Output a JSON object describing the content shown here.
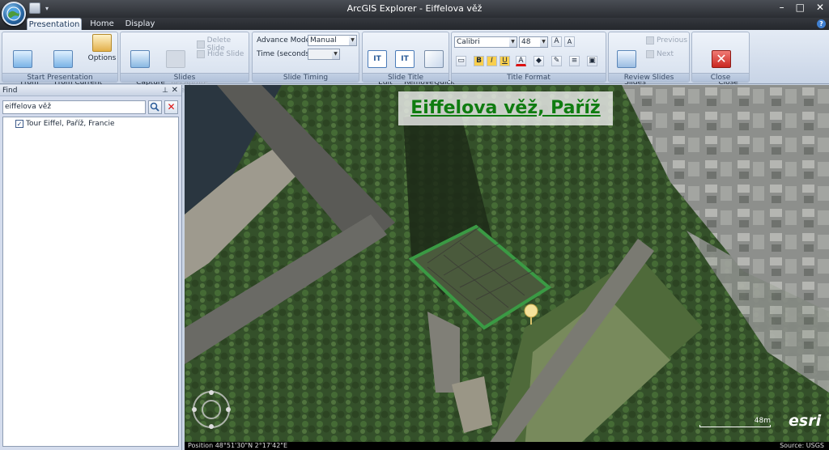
{
  "window": {
    "title": "ArcGIS Explorer - Eiffelova věž"
  },
  "tabs": [
    {
      "label": "Presentation"
    },
    {
      "label": "Home"
    },
    {
      "label": "Display"
    }
  ],
  "ribbon": {
    "start_presentation": {
      "caption": "Start Presentation",
      "from_beginning": "From\nBeginning",
      "from_current": "From Current\nSlide",
      "options": "Options"
    },
    "slides": {
      "caption": "Slides",
      "capture": "Capture\nNew Slide",
      "recapture": "Recapture\nSlide",
      "delete": "Delete Slide",
      "hide": "Hide Slide"
    },
    "slide_timing": {
      "caption": "Slide Timing",
      "advance_mode_label": "Advance Mode:",
      "advance_mode_value": "Manual",
      "time_label": "Time (seconds):",
      "time_value": ""
    },
    "slide_title": {
      "caption": "Slide Title",
      "edit": "Edit\nText",
      "remove": "Remove\nTitle",
      "quick_styles": "Quick\nStyles"
    },
    "title_format": {
      "caption": "Title Format",
      "font": "Calibri",
      "size": "48",
      "bold": "B",
      "italic": "I",
      "underline": "U"
    },
    "review_slides": {
      "caption": "Review Slides",
      "slides_window": "Slides\nWindow",
      "previous": "Previous",
      "next": "Next"
    },
    "close": {
      "caption": "Close",
      "close_tab": "Close\nPresentation Tab"
    }
  },
  "find": {
    "title": "Find",
    "query": "eiffelova věž",
    "results": [
      {
        "label": "Tour Eiffel, Paříž, Francie",
        "checked": true
      }
    ]
  },
  "map": {
    "slide_title": "Eiffelova věž, Paříž",
    "position": "Position 48°51'30\"N  2°17'42\"E",
    "source": "Source: USGS",
    "scale": "48m",
    "logo": "esri"
  },
  "colors": {
    "accent": "#0f7c10",
    "close_red": "#d9312d"
  }
}
